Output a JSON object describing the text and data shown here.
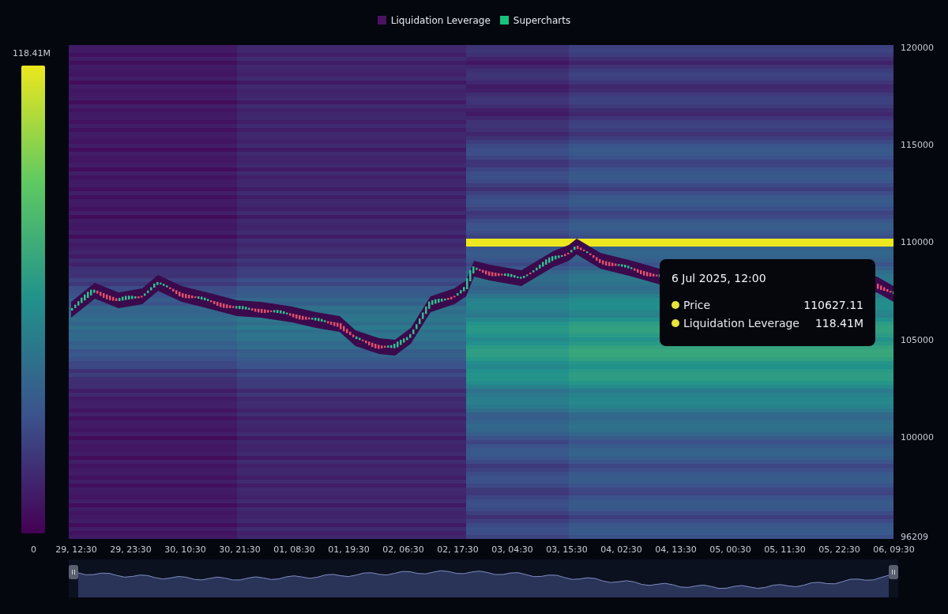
{
  "legend": [
    {
      "label": "Liquidation Leverage",
      "color": "#4a1460"
    },
    {
      "label": "Supercharts",
      "color": "#17c27d"
    }
  ],
  "color_scale": {
    "max_label": "118.41M",
    "min_label": "0"
  },
  "y_axis": {
    "ticks": [
      "120000",
      "115000",
      "110000",
      "105000",
      "100000"
    ],
    "min_label": "96209"
  },
  "x_axis": {
    "labels": [
      "29, 12:30",
      "29, 23:30",
      "30, 10:30",
      "30, 21:30",
      "01, 08:30",
      "01, 19:30",
      "02, 06:30",
      "02, 17:30",
      "03, 04:30",
      "03, 15:30",
      "04, 02:30",
      "04, 13:30",
      "05, 00:30",
      "05, 11:30",
      "05, 22:30",
      "06, 09:30"
    ]
  },
  "tooltip": {
    "title": "6 Jul 2025, 12:00",
    "rows": [
      {
        "label": "Price",
        "value": "110627.11",
        "color": "#e8e33a"
      },
      {
        "label": "Liquidation Leverage",
        "value": "118.41M",
        "color": "#e8e33a"
      }
    ]
  }
}
